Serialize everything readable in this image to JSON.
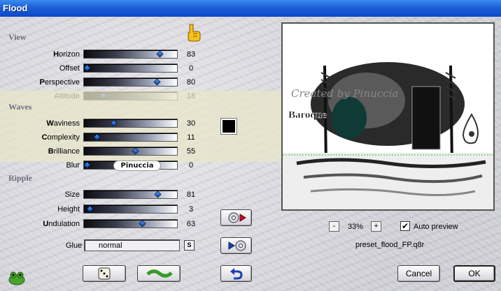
{
  "window": {
    "title": "Flood"
  },
  "sections": {
    "view": {
      "title": "View",
      "sliders": [
        {
          "label": "Horizon",
          "hotkey": "H",
          "value": "83",
          "level": 0.83
        },
        {
          "label": "Offset",
          "hotkey": "",
          "value": "0",
          "level": 0.0
        },
        {
          "label": "Perspective",
          "hotkey": "P",
          "value": "80",
          "level": 0.8
        },
        {
          "label": "Altitude",
          "hotkey": "",
          "value": "18",
          "level": 0.18
        }
      ]
    },
    "waves": {
      "title": "Waves",
      "sliders": [
        {
          "label": "Waviness",
          "hotkey": "W",
          "value": "30",
          "level": 0.3
        },
        {
          "label": "Complexity",
          "hotkey": "C",
          "value": "11",
          "level": 0.11
        },
        {
          "label": "Brilliance",
          "hotkey": "B",
          "value": "55",
          "level": 0.55
        },
        {
          "label": "Blur",
          "hotkey": "",
          "value": "0",
          "level": 0.0
        }
      ],
      "color": "#000000"
    },
    "ripple": {
      "title": "Ripple",
      "sliders": [
        {
          "label": "Size",
          "hotkey": "",
          "value": "81",
          "level": 0.81
        },
        {
          "label": "Height",
          "hotkey": "",
          "value": "3",
          "level": 0.03
        },
        {
          "label": "Undulation",
          "hotkey": "U",
          "value": "63",
          "level": 0.63
        }
      ]
    }
  },
  "glue": {
    "label": "Glue",
    "value": "normal",
    "lock_label": "S"
  },
  "signature": "Pinuccia",
  "preview": {
    "watermark": "Created by Pinuccia",
    "title_text": "Baroque",
    "zoom": "33%",
    "zoom_minus": "-",
    "zoom_plus": "+",
    "auto_preview_label": "Auto preview",
    "auto_preview_checked": true,
    "preset_name": "preset_flood_FP.q8r"
  },
  "buttons": {
    "cancel": "Cancel",
    "ok": "OK"
  },
  "colors": {
    "titlebar": "#1d5fd6",
    "waves_band": "#e8e6c8",
    "accent_red": "#c0102a",
    "accent_blue": "#1a3fb0"
  }
}
